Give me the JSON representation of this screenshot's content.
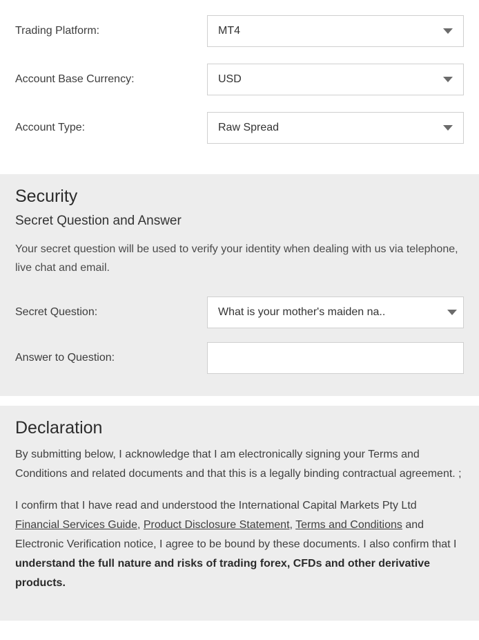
{
  "account": {
    "platform_label": "Trading Platform:",
    "platform_value": "MT4",
    "currency_label": "Account Base Currency:",
    "currency_value": "USD",
    "type_label": "Account Type:",
    "type_value": "Raw Spread"
  },
  "security": {
    "heading": "Security",
    "subheading": "Secret Question and Answer",
    "description": "Your secret question will be used to verify your identity when dealing with us via telephone, live chat and email.",
    "question_label": "Secret Question:",
    "question_value": "What is your mother's maiden na..",
    "answer_label": "Answer to Question:",
    "answer_value": ""
  },
  "declaration": {
    "heading": "Declaration",
    "p1": "By submitting below, I acknowledge that I am electronically signing your Terms and Conditions and related documents and that this is a legally binding contractual agreement. ;",
    "p2_pre": "I confirm that I have read and understood the International Capital Markets Pty Ltd ",
    "link1": "Financial Services Guide",
    "sep1": ", ",
    "link2": "Product Disclosure Statement",
    "sep2": ", ",
    "link3": "Terms and Conditions",
    "p2_mid": " and Electronic Verification notice, I agree to be bound by these documents. I also confirm that I ",
    "bold": "understand the full nature and risks of trading forex, CFDs and other derivative products."
  }
}
